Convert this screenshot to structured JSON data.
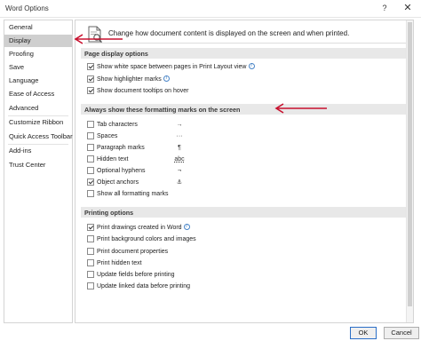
{
  "window": {
    "title": "Word Options",
    "help": "?",
    "close": "✕"
  },
  "sidebar": {
    "items": [
      {
        "label": "General"
      },
      {
        "label": "Display"
      },
      {
        "label": "Proofing"
      },
      {
        "label": "Save"
      },
      {
        "label": "Language"
      },
      {
        "label": "Ease of Access"
      },
      {
        "label": "Advanced"
      },
      {
        "label": "Customize Ribbon"
      },
      {
        "label": "Quick Access Toolbar"
      },
      {
        "label": "Add-ins"
      },
      {
        "label": "Trust Center"
      }
    ],
    "selected": "Display"
  },
  "header": {
    "text": "Change how document content is displayed on the screen and when printed."
  },
  "page_display": {
    "title": "Page display options",
    "options": [
      {
        "label": "Show white space between pages in Print Layout view",
        "checked": true,
        "info": true
      },
      {
        "label": "Show highlighter marks",
        "checked": true,
        "info": true
      },
      {
        "label": "Show document tooltips on hover",
        "checked": true,
        "info": false
      }
    ]
  },
  "formatting": {
    "title": "Always show these formatting marks on the screen",
    "options": [
      {
        "label": "Tab characters",
        "checked": false,
        "mark": "→"
      },
      {
        "label": "Spaces",
        "checked": false,
        "mark": "···"
      },
      {
        "label": "Paragraph marks",
        "checked": false,
        "mark": "¶"
      },
      {
        "label": "Hidden text",
        "checked": false,
        "mark": "abc"
      },
      {
        "label": "Optional hyphens",
        "checked": false,
        "mark": "¬"
      },
      {
        "label": "Object anchors",
        "checked": true,
        "mark": "⚓"
      },
      {
        "label": "Show all formatting marks",
        "checked": false,
        "mark": ""
      }
    ]
  },
  "printing": {
    "title": "Printing options",
    "options": [
      {
        "label": "Print drawings created in Word",
        "checked": true,
        "info": true
      },
      {
        "label": "Print background colors and images",
        "checked": false,
        "info": false
      },
      {
        "label": "Print document properties",
        "checked": false,
        "info": false
      },
      {
        "label": "Print hidden text",
        "checked": false,
        "info": false
      },
      {
        "label": "Update fields before printing",
        "checked": false,
        "info": false
      },
      {
        "label": "Update linked data before printing",
        "checked": false,
        "info": false
      }
    ]
  },
  "footer": {
    "ok": "OK",
    "cancel": "Cancel"
  },
  "colors": {
    "arrow": "#c8102e",
    "selected": "#cfcfcf",
    "section": "#e8e8e8"
  }
}
